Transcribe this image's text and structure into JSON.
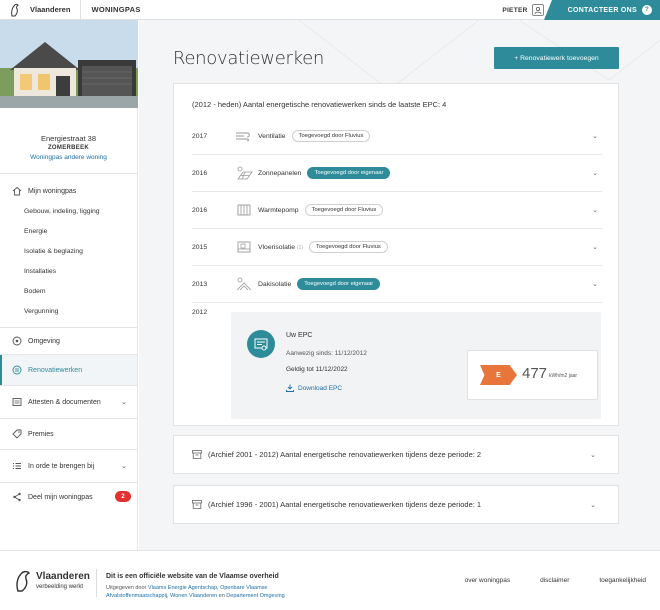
{
  "topbar": {
    "brand": "Vlaanderen",
    "app_name": "WONINGPAS",
    "user": "PIETER",
    "contact_label": "CONTACTEER ONS",
    "contact_badge": "?"
  },
  "sidebar": {
    "address": {
      "street": "Energiestraat 38",
      "city": "ZOMERBEEK",
      "switch_link": "Woningpas andere woning"
    },
    "nav": {
      "mijn_woningpas": "Mijn woningpas",
      "subitems": [
        "Gebouw, indeling, ligging",
        "Energie",
        "Isolatie & beglazing",
        "Installaties",
        "Bodem",
        "Vergunning"
      ],
      "omgeving": "Omgeving",
      "renovatiewerken": "Renovatiewerken",
      "attesten": "Attesten & documenten",
      "premies": "Premies",
      "in_orde": "In orde te brengen bij",
      "deel": "Deel mijn woningpas",
      "deel_badge": "2"
    }
  },
  "main": {
    "title": "Renovatiewerken",
    "add_button": "+ Renovatiewerk toevoegen",
    "card_heading": "(2012 - heden) Aantal energetische renovatiewerken sinds de laatste EPC: 4",
    "rows": [
      {
        "year": "2017",
        "label": "Ventilatie",
        "badge": "Toegevoegd door Fluvius",
        "badge_style": "outline"
      },
      {
        "year": "2016",
        "label": "Zonnepanelen",
        "badge": "Toegevoegd door eigenaar",
        "badge_style": "teal"
      },
      {
        "year": "2016",
        "label": "Warmtepomp",
        "badge": "Toegevoegd door Fluvius",
        "badge_style": "outline"
      },
      {
        "year": "2015",
        "label": "Vloerisolatie",
        "label_suffix": "(1)",
        "badge": "Toegevoegd door Fluvius",
        "badge_style": "outline"
      },
      {
        "year": "2013",
        "label": "Dakisolatie",
        "badge": "Toegevoegd door eigenaar",
        "badge_style": "teal"
      }
    ],
    "epc": {
      "year": "2012",
      "title": "Uw EPC",
      "since": "Aanwezig sinds: 11/12/2012",
      "valid": "Geldig tot 11/12/2022",
      "download": "Download EPC",
      "label": "E",
      "score": "477",
      "unit": "kWh/m2 jaar",
      "label_color": "#e8763a"
    },
    "archives": [
      "(Archief 2001 - 2012) Aantal energetische renovatiewerken tijdens deze periode: 2",
      "(Archief 1996 - 2001) Aantal energetische renovatiewerken tijdens deze periode: 1"
    ]
  },
  "footer": {
    "brand": "Vlaanderen",
    "brand_sub": "verbeelding werkt",
    "title": "Dit is een officiële website van de Vlaamse overheid",
    "desc_prefix": "Uitgegeven door",
    "desc_links": [
      "Vlaams Energie Agentschap",
      "Openbare Vlaamse Afvalstoffenmaatschappij",
      "Wonen Vlaanderen",
      "Departement Omgeving"
    ],
    "desc_and": "en",
    "links": [
      "over woningpas",
      "disclaimer",
      "toegankelijkheid"
    ]
  },
  "colors": {
    "accent": "#2e8b9a",
    "link": "#1d6fa5",
    "badge_red": "#e2302f"
  }
}
